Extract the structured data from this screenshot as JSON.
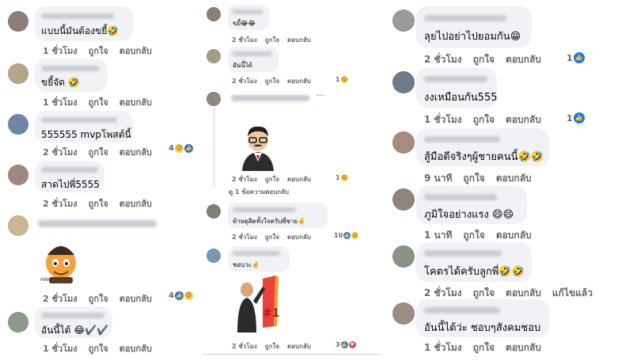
{
  "labels": {
    "like": "ถูกใจ",
    "reply": "ตอบกลับ"
  },
  "col1": [
    {
      "text": "แบบนี้มันต้องขยี้🤣",
      "time": "1 ชั่วโมง",
      "reacts": null
    },
    {
      "text": "ขยี้จัด 🤣",
      "time": "1 ชั่วโมง",
      "reacts": null
    },
    {
      "text": "555555 mvpโพสต์นี้",
      "time": "2 ชั่วโมง",
      "reacts": "4"
    },
    {
      "text": "สาดไปพี่5555",
      "time": "2 ชั่วโมง",
      "reacts": null
    },
    {
      "text": "",
      "time": "2 ชั่วโมง",
      "reacts": "4",
      "sticker": "cartoon-character-sticker",
      "sticker_caption": "HAHA"
    },
    {
      "text": "อันนี้ได้ 😂✔️✔️",
      "time": "1 ชั่วโมง",
      "reacts": null
    }
  ],
  "col2": [
    {
      "text": "ขยี้😂😂",
      "time": "2 ชั่วโมง",
      "reacts": null
    },
    {
      "text": "อันนี้ได้",
      "time": "2 ชั่วโมง",
      "reacts": "1"
    },
    {
      "text": "",
      "time": "2 ชั่วโมง",
      "reacts": "1",
      "sticker": "man-in-suit-sticker"
    },
    {
      "text": "ท้ายดุสิตทั้งใจครับพี่ชาย🤞",
      "time": "2 ชั่วโมง",
      "reacts": "10"
    },
    {
      "text": "ชอบวะ🤞",
      "time": "2 ชั่วโมง",
      "reacts": "3",
      "sticker": "number-one-sticker"
    }
  ],
  "col2_view_replies": "ดู 1 ข้อความตอบกลับ",
  "col2_more": "···",
  "col3": [
    {
      "text": "ลุยไปอย่าไปยอมกัน😁",
      "time": "2 ชั่วโมง",
      "reacts": "1"
    },
    {
      "text": "งงเหมือนกัน555",
      "time": "1 ชั่วโมง",
      "reacts": "1"
    },
    {
      "text": "สู้มือดีจริงๆผู้ชายคนนี้🤣🤣",
      "time": "9 นาที",
      "reacts": null
    },
    {
      "text": "ภูมิใจอย่างแรง 😄😄",
      "time": "1 นาที",
      "reacts": null
    },
    {
      "text": "โคตรได้ครับลูกพี่🤣🤣",
      "time": "2 ชั่วโมง",
      "reacts": null,
      "edited": "แก้ไขแล้ว"
    },
    {
      "text": "อันนี้ได้ว่ะ ชอบๆสังคมชอบ",
      "time": "1 ชั่วโมง",
      "reacts": null
    }
  ],
  "sticker_text": {
    "number_one": "#1",
    "haha": "HAHA"
  },
  "colors": {
    "like": "#1877f2",
    "haha": "#f7c948",
    "love": "#f33e58",
    "bubble": "#f0f2f5",
    "meta": "#65676b"
  }
}
